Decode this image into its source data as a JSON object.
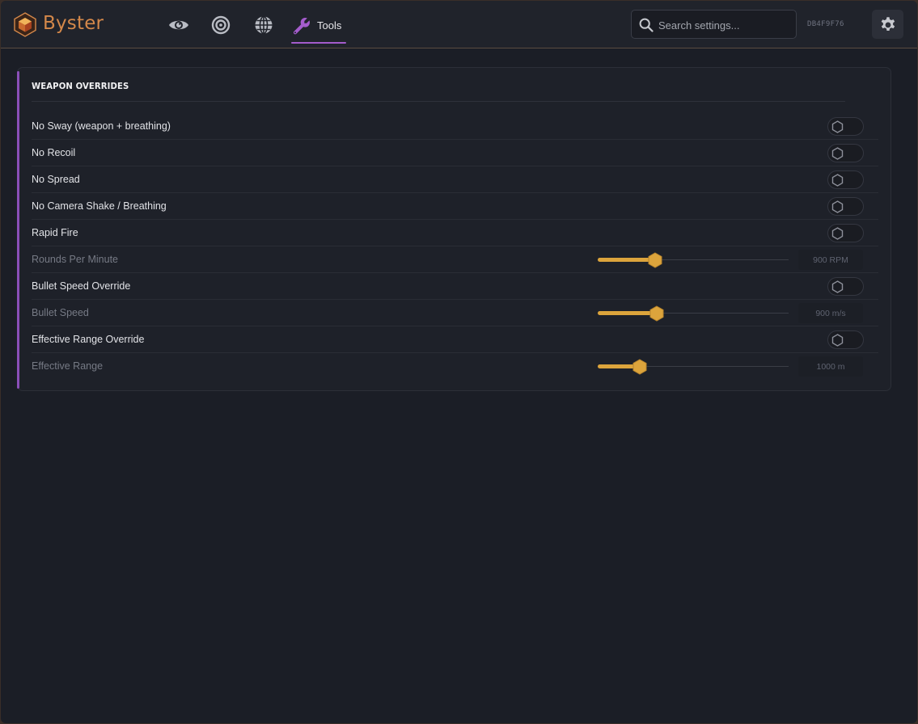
{
  "app": {
    "brand": "Byster",
    "hwid": "DB4F9F76"
  },
  "colors": {
    "accent_purple": "#a45ccc",
    "accent_orange": "#dca43c",
    "background": "#1b1e26"
  },
  "nav": {
    "items": [
      {
        "icon": "eye-icon"
      },
      {
        "icon": "target-icon"
      },
      {
        "icon": "globe-icon"
      },
      {
        "icon": "wrench-icon",
        "label": "Tools",
        "active": true
      }
    ]
  },
  "search": {
    "placeholder": "Search settings...",
    "value": ""
  },
  "section": {
    "title": "WEAPON OVERRIDES",
    "rows": [
      {
        "type": "toggle",
        "label": "No Sway (weapon + breathing)",
        "enabled": false
      },
      {
        "type": "toggle",
        "label": "No Recoil",
        "enabled": false
      },
      {
        "type": "toggle",
        "label": "No Spread",
        "enabled": false
      },
      {
        "type": "toggle",
        "label": "No Camera Shake / Breathing",
        "enabled": false
      },
      {
        "type": "toggle",
        "label": "Rapid Fire",
        "enabled": false
      },
      {
        "type": "slider",
        "label": "Rounds Per Minute",
        "value": "900 RPM",
        "fraction": 0.3,
        "disabled": true
      },
      {
        "type": "toggle",
        "label": "Bullet Speed Override",
        "enabled": false
      },
      {
        "type": "slider",
        "label": "Bullet Speed",
        "value": "900 m/s",
        "fraction": 0.31,
        "disabled": true
      },
      {
        "type": "toggle",
        "label": "Effective Range Override",
        "enabled": false
      },
      {
        "type": "slider",
        "label": "Effective Range",
        "value": "1000 m",
        "fraction": 0.22,
        "disabled": true
      }
    ]
  }
}
